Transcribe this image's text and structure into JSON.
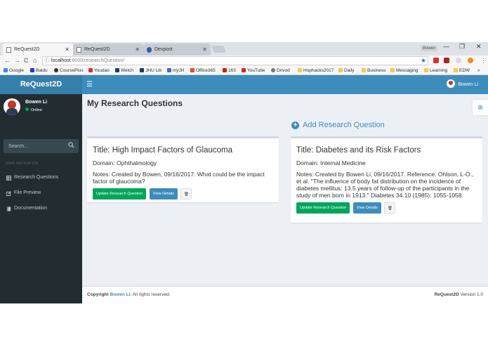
{
  "browser": {
    "tabs": [
      {
        "label": "ReQuest2D",
        "icon": "page-icon",
        "active": true
      },
      {
        "label": "ReQuest2D",
        "icon": "page-icon",
        "active": false
      },
      {
        "label": "Devpost",
        "icon": "devpost-icon",
        "active": false
      }
    ],
    "tab_close": "✕",
    "profile_name": "Bowen",
    "window_controls": {
      "minimize": "—",
      "maximize": "❐",
      "close": "✕"
    },
    "nav": {
      "back": "←",
      "forward": "→",
      "reload": "C",
      "home": "⌂"
    },
    "url_host": "localhost",
    "url_rest": ":8000/researchQuestion/",
    "bookmarks": [
      {
        "label": "Google",
        "icon": "google-icon"
      },
      {
        "label": "Baidu",
        "icon": "baidu-icon"
      },
      {
        "label": "CoursePlus",
        "icon": "courseplus-icon"
      },
      {
        "label": "Youdao",
        "icon": "youdao-icon"
      },
      {
        "label": "Welch",
        "icon": "welch-icon"
      },
      {
        "label": "JHU Lib",
        "icon": "jhu-icon"
      },
      {
        "label": "myJH",
        "icon": "myjh-icon"
      },
      {
        "label": "Office365",
        "icon": "office-icon"
      },
      {
        "label": "163",
        "icon": "netease-icon"
      },
      {
        "label": "YouTube",
        "icon": "youtube-icon"
      },
      {
        "label": "Dnvod",
        "icon": "dnvod-icon"
      },
      {
        "label": "Hophacks2017",
        "icon": "folder-icon"
      },
      {
        "label": "Daily",
        "icon": "folder-icon"
      },
      {
        "label": "Business",
        "icon": "folder-icon"
      },
      {
        "label": "Messaging",
        "icon": "folder-icon"
      },
      {
        "label": "Learning",
        "icon": "folder-icon"
      },
      {
        "label": "EDW",
        "icon": "folder-icon"
      }
    ],
    "bookmarks_more": "»"
  },
  "app": {
    "brand": "ReQuest2D",
    "header_user": "Bowen Li",
    "sidebar": {
      "user_name": "Bowen Li",
      "user_status": "Online",
      "search_placeholder": "Search...",
      "nav_header": "MAIN NAVIGATION",
      "items": [
        {
          "label": "Research Questions",
          "icon": "table-icon"
        },
        {
          "label": "File Preview",
          "icon": "edit-icon"
        },
        {
          "label": "Documentation",
          "icon": "book-icon"
        }
      ]
    },
    "page_title": "My Research Questions",
    "add_label": "Add Research Question",
    "cards": [
      {
        "title": "Title: High Impact Factors of Glaucoma",
        "domain": "Domain: Ophthalmology",
        "notes": "Notes: Created by Bowen, 09/16/2017. What could be the impact factor of glaucoma?"
      },
      {
        "title": "Title: Diabetes and its Risk Factors",
        "domain": "Domain: Internal Medicine",
        "notes": "Notes: Created by Bowen Li, 09/16/2017. Reference: Ohlson, L-O., et al. \"The influence of body fat distribution on the incidence of diabetes mellitus: 13.5 years of follow-up of the participants in the study of men born in 1913.\" Diabetes 34.10 (1985): 1055-1058."
      }
    ],
    "buttons": {
      "update": "Update Research Question",
      "view": "View Details",
      "delete": "🗑"
    },
    "footer": {
      "copyright_prefix": "Copyright",
      "copyright_name": "Bowen Li.",
      "copyright_suffix": "All rights reserved.",
      "version_brand": "ReQuest2D",
      "version_text": "Version 1.0"
    },
    "colors": {
      "primary": "#3c8dbc",
      "logo_bg": "#367fa9",
      "sidebar_bg": "#222d32",
      "success": "#00a65a",
      "content_bg": "#ecf0f5"
    }
  }
}
